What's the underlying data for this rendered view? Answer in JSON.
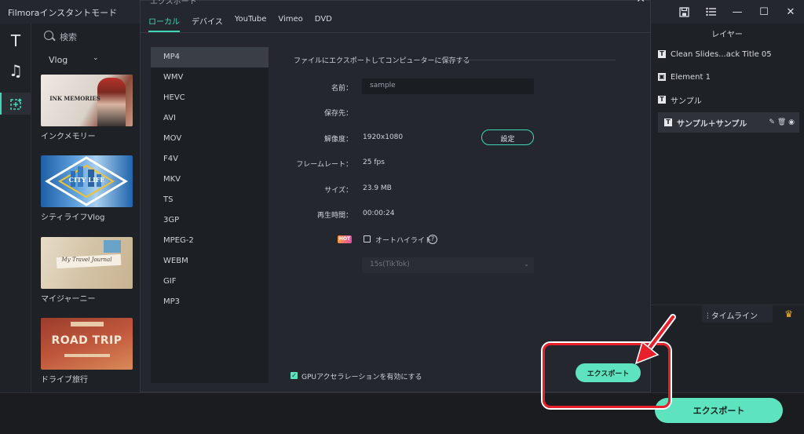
{
  "app": {
    "title": "Filmoraインスタントモード"
  },
  "window_controls": {
    "save_icon": "save-icon",
    "menu_icon": "list-icon",
    "minimize": "—",
    "maximize": "☐",
    "close": "✕"
  },
  "rail": {
    "text": "T",
    "music": "♫",
    "template": "✚"
  },
  "library": {
    "search_placeholder": "検索",
    "filter_label": "Vlog",
    "items": [
      {
        "label": "インクメモリー",
        "thumb_text": "INK MEMORIES"
      },
      {
        "label": "シティライフVlog",
        "thumb_text": "CITY LIFE"
      },
      {
        "label": "マイジャーニー",
        "thumb_text": "My Travel Journal"
      },
      {
        "label": "ドライブ旅行",
        "thumb_text": "ROAD TRIP"
      }
    ]
  },
  "layers": {
    "header": "レイヤー",
    "items": [
      {
        "label": "Clean Slides...ack Title 05"
      },
      {
        "label": "Element 1"
      },
      {
        "label": "サンプル"
      },
      {
        "label": "サンプル＋サンプル",
        "selected": true
      }
    ],
    "timeline_label": "タイムライン"
  },
  "main": {
    "export_label": "エクスポート"
  },
  "dialog": {
    "title": "エクスポート",
    "tabs": [
      "ローカル",
      "デバイス",
      "YouTube",
      "Vimeo",
      "DVD"
    ],
    "active_tab": "ローカル",
    "formats": [
      "MP4",
      "WMV",
      "HEVC",
      "AVI",
      "MOV",
      "F4V",
      "MKV",
      "TS",
      "3GP",
      "MPEG-2",
      "WEBM",
      "GIF",
      "MP3"
    ],
    "active_format": "MP4",
    "section_title": "ファイルにエクスポートしてコンピューターに保存する",
    "fields": {
      "name_label": "名前：",
      "name_value": "sample",
      "save_label": "保存先：",
      "resolution_label": "解像度：",
      "resolution_value": "1920x1080",
      "settings_button": "設定",
      "framerate_label": "フレームレート：",
      "framerate_value": "25 fps",
      "size_label": "サイズ：",
      "size_value": "23.9 MB",
      "duration_label": "再生時間：",
      "duration_value": "00:00:24",
      "hot_badge": "HOT",
      "autohighlight_label": "オートハイライト",
      "autohighlight_checked": false,
      "duration_select": "15s(TikTok)"
    },
    "gpu_label": "GPUアクセラレーションを有効にする",
    "gpu_checked": true,
    "export_button": "エクスポート"
  },
  "colors": {
    "accent": "#5ee3bf",
    "highlight": "#e8202c"
  }
}
